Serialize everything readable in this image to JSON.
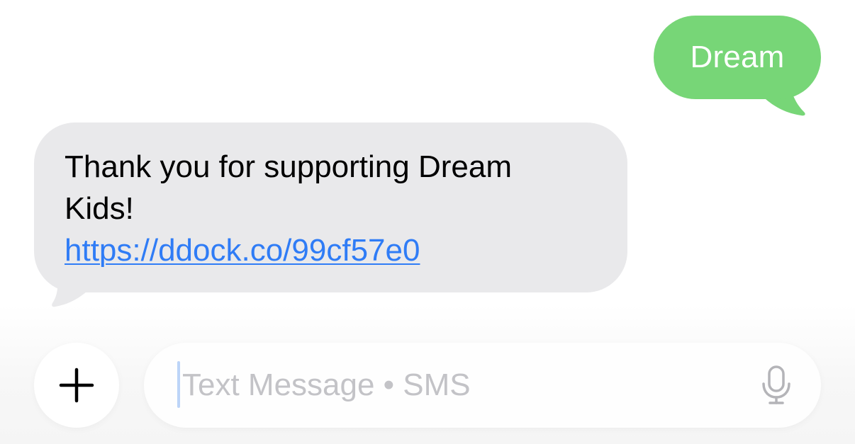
{
  "thread": {
    "sent": [
      {
        "text": "Dream"
      }
    ],
    "received": [
      {
        "lines": [
          "Thank you for supporting Dream",
          "Kids!"
        ],
        "link": "https://ddock.co/99cf57e0"
      }
    ]
  },
  "composer": {
    "placeholder": "Text Message • SMS"
  },
  "colors": {
    "sent_bubble": "#77d677",
    "received_bubble": "#e9e9eb",
    "link": "#2f7cf6",
    "placeholder": "#c3c3c7"
  },
  "icons": {
    "add": "plus-icon",
    "dictation": "microphone-icon"
  }
}
